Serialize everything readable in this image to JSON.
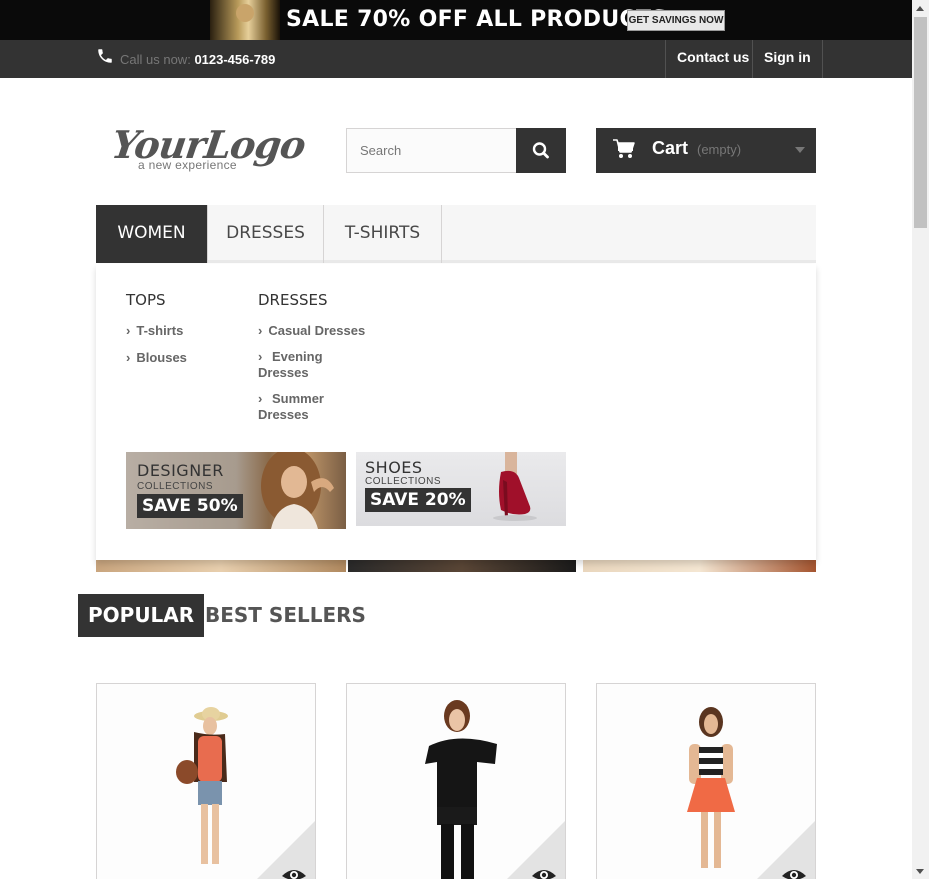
{
  "promo_banner": {
    "headline": "SALE 70% OFF ALL PRODUCTS",
    "cta_label": "GET SAVINGS NOW"
  },
  "header_nav": {
    "call_label": "Call us now:",
    "phone": "0123-456-789",
    "contact_label": "Contact us",
    "signin_label": "Sign in"
  },
  "logo": {
    "text": "YourLogo",
    "tagline": "a new experience"
  },
  "search": {
    "placeholder": "Search",
    "value": ""
  },
  "cart": {
    "label": "Cart",
    "status": "(empty)"
  },
  "menu": {
    "items": [
      {
        "label": "WOMEN",
        "active": true
      },
      {
        "label": "DRESSES",
        "active": false
      },
      {
        "label": "T-SHIRTS",
        "active": false
      }
    ]
  },
  "dropdown": {
    "columns": [
      {
        "heading": "TOPS",
        "links": [
          "T-shirts",
          "Blouses"
        ]
      },
      {
        "heading": "DRESSES",
        "links": [
          "Casual Dresses",
          "Evening Dresses",
          "Summer Dresses"
        ]
      }
    ],
    "banners": [
      {
        "title": "DESIGNER",
        "subtitle": "COLLECTIONS",
        "save": "SAVE 50%"
      },
      {
        "title": "SHOES",
        "subtitle": "COLLECTIONS",
        "save": "SAVE 20%"
      }
    ]
  },
  "tabs": [
    {
      "label": "POPULAR",
      "active": true
    },
    {
      "label": "BEST SELLERS",
      "active": false
    }
  ],
  "colors": {
    "dark": "#333333",
    "link_gray": "#666666",
    "menu_bg": "#f6f6f6",
    "border": "#d6d4d4"
  },
  "icons": [
    "phone-icon",
    "search-icon",
    "cart-icon",
    "chevron-right-icon",
    "eye-icon",
    "caret-down-icon"
  ]
}
